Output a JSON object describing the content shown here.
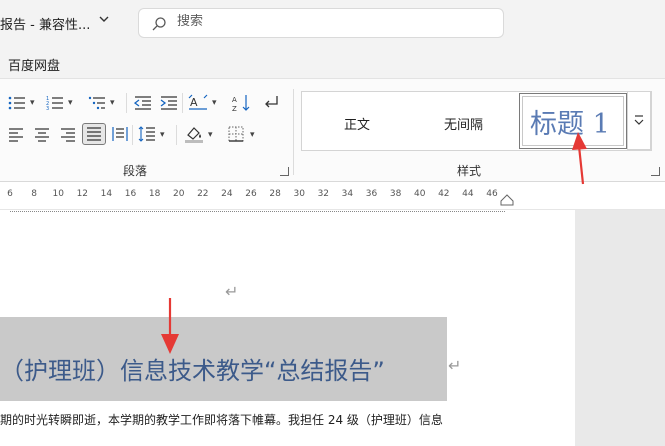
{
  "titlebar": {
    "doc_title": "报告 - 兼容性...",
    "search_placeholder": "搜索"
  },
  "tabs": [
    "百度网盘"
  ],
  "ribbon": {
    "paragraph_group_label": "段落",
    "styles_group_label": "样式",
    "styles": [
      "正文",
      "无间隔",
      "标题 1"
    ]
  },
  "ruler": {
    "numbers": [
      "6",
      "8",
      "10",
      "12",
      "14",
      "16",
      "18",
      "20",
      "22",
      "24",
      "26",
      "28",
      "30",
      "32",
      "34",
      "36",
      "38",
      "40",
      "42",
      "44",
      "46"
    ]
  },
  "document": {
    "heading": "（护理班）信息技术教学“总结报告”",
    "body_line": "期的时光转瞬即逝，本学期的教学工作即将落下帷幕。我担任 24 级（护理班）信息"
  },
  "colors": {
    "accent_red": "#e53935",
    "heading_blue": "#3c5a8a",
    "selection_gray": "#c9c9c9"
  }
}
